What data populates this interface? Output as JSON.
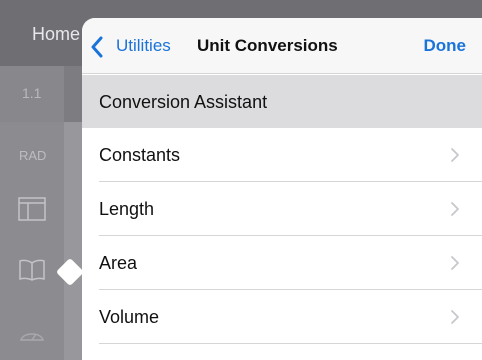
{
  "background": {
    "home_label": "Home",
    "tab_label": "1.1",
    "angle_mode": "RAD",
    "sidebar_icons": [
      "layout-icon",
      "book-icon",
      "gauge-icon"
    ]
  },
  "popover": {
    "back_label": "Utilities",
    "title": "Unit Conversions",
    "done_label": "Done",
    "highlighted_item": "Conversion Assistant",
    "items": [
      {
        "label": "Constants"
      },
      {
        "label": "Length"
      },
      {
        "label": "Area"
      },
      {
        "label": "Volume"
      }
    ]
  },
  "colors": {
    "accent": "#1a73d9",
    "highlight": "#dcdcde",
    "dim_background": "#8a8a8e"
  }
}
